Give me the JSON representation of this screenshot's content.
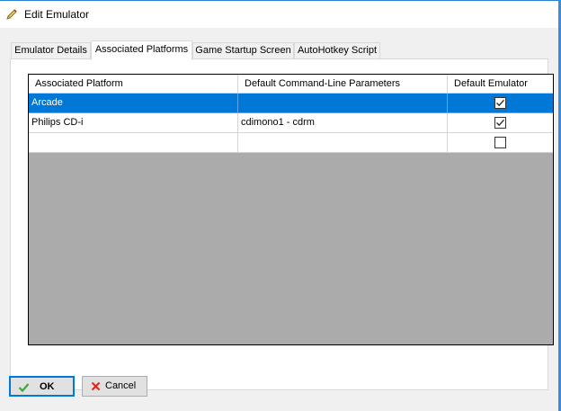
{
  "window": {
    "title": "Edit Emulator",
    "title_icon": "pencil-icon"
  },
  "tabs": [
    {
      "label": "Emulator Details",
      "active": false
    },
    {
      "label": "Associated Platforms",
      "active": true
    },
    {
      "label": "Game Startup Screen",
      "active": false
    },
    {
      "label": "AutoHotkey Script",
      "active": false
    }
  ],
  "grid": {
    "columns": [
      "Associated Platform",
      "Default Command-Line Parameters",
      "Default Emulator"
    ],
    "rows": [
      {
        "platform": "Arcade",
        "params": "",
        "default": true,
        "selected": true
      },
      {
        "platform": "Philips CD-i",
        "params": "cdimono1 - cdrm",
        "default": true,
        "selected": false
      },
      {
        "platform": "",
        "params": "",
        "default": false,
        "selected": false
      }
    ]
  },
  "buttons": {
    "ok": {
      "label": "OK",
      "icon": "checkmark-icon"
    },
    "cancel": {
      "label": "Cancel",
      "icon": "x-icon"
    }
  },
  "colors": {
    "selection": "#0078d7",
    "grid_empty": "#ababab",
    "ok_check": "#3aa83a",
    "cancel_x": "#d9281e"
  }
}
